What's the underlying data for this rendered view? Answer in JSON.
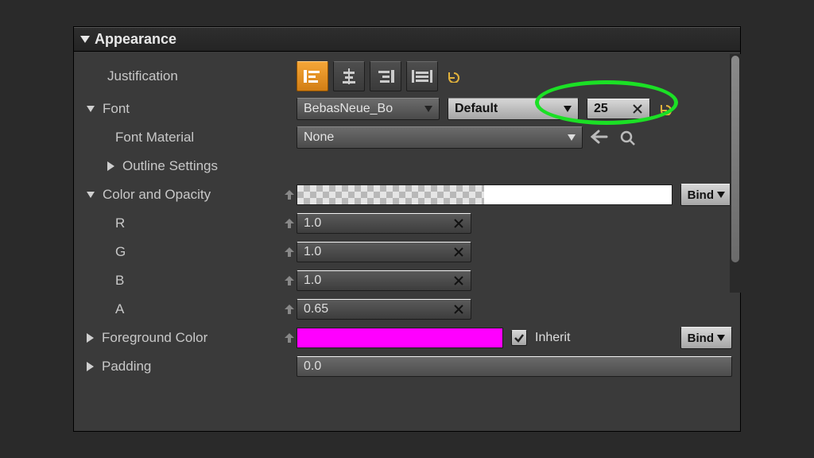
{
  "section_title": "Appearance",
  "labels": {
    "justification": "Justification",
    "font": "Font",
    "font_material": "Font Material",
    "outline_settings": "Outline Settings",
    "color_opacity": "Color and Opacity",
    "r": "R",
    "g": "G",
    "b": "B",
    "a": "A",
    "foreground_color": "Foreground Color",
    "padding": "Padding",
    "inherit": "Inherit",
    "bind": "Bind"
  },
  "font": {
    "family": "BebasNeue_Bo",
    "typeface": "Default",
    "size": "25",
    "material": "None"
  },
  "color_opacity": {
    "r": "1.0",
    "g": "1.0",
    "b": "1.0",
    "a": "0.65"
  },
  "foreground_color": "#ff00ff",
  "inherit_checked": true,
  "padding": "0.0"
}
